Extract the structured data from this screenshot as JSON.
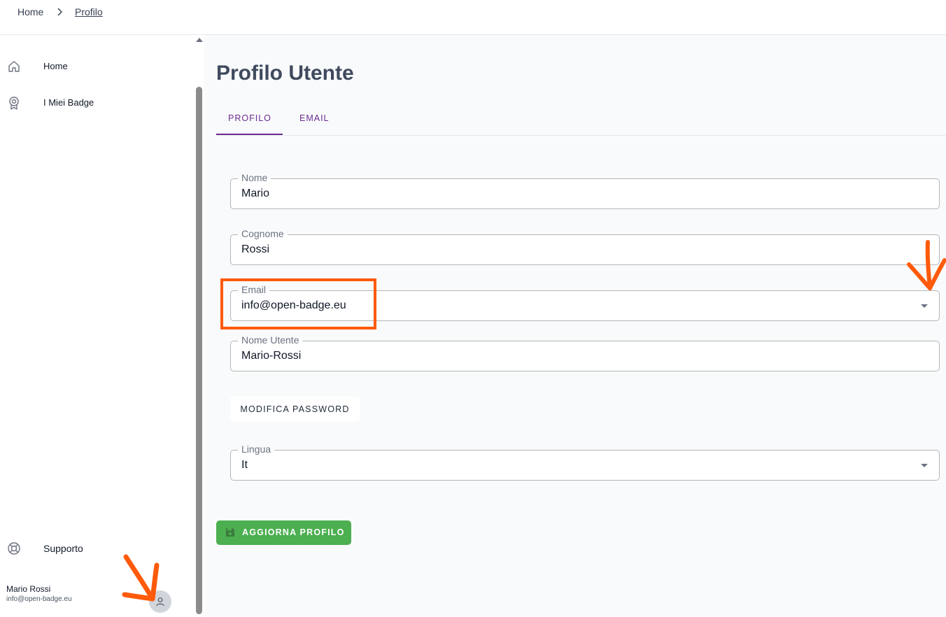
{
  "breadcrumb": {
    "home": "Home",
    "current": "Profilo"
  },
  "sidebar": {
    "items": [
      {
        "label": "Home",
        "icon": "home-icon"
      },
      {
        "label": "I Miei Badge",
        "icon": "badge-icon"
      }
    ],
    "support": {
      "label": "Supporto",
      "icon": "lifebuoy-icon"
    },
    "user": {
      "name": "Mario Rossi",
      "email": "info@open-badge.eu",
      "icon": "user-icon"
    }
  },
  "main": {
    "title": "Profilo Utente",
    "tabs": [
      {
        "label": "PROFILO",
        "active": true
      },
      {
        "label": "EMAIL",
        "active": false
      }
    ],
    "fields": {
      "nome": {
        "label": "Nome",
        "value": "Mario"
      },
      "cognome": {
        "label": "Cognome",
        "value": "Rossi"
      },
      "email": {
        "label": "Email",
        "value": "info@open-badge.eu"
      },
      "username": {
        "label": "Nome Utente",
        "value": "Mario-Rossi"
      },
      "lingua": {
        "label": "Lingua",
        "value": "It"
      }
    },
    "change_password_label": "MODIFICA PASSWORD",
    "update_label": "AGGIORNA PROFILO"
  },
  "colors": {
    "accent": "#6b2c91",
    "success": "#4caf50",
    "annotation": "#ff5a0a",
    "title": "#3f4a5e"
  }
}
